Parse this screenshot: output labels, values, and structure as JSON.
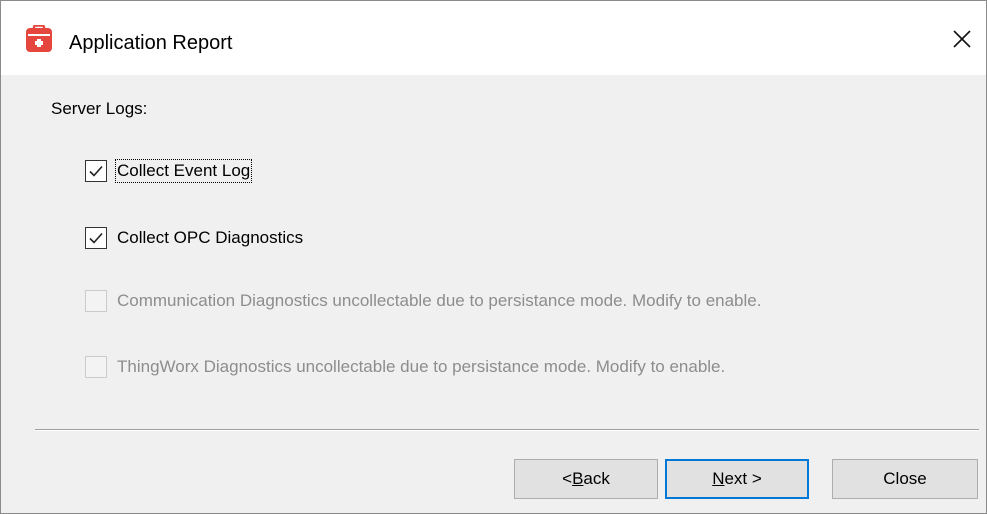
{
  "window": {
    "title": "Application Report",
    "icon": "toolbox-icon",
    "close_glyph": "✕"
  },
  "section": {
    "label": "Server Logs:"
  },
  "checkboxes": [
    {
      "label": "Collect Event Log",
      "checked": true,
      "enabled": true,
      "focused": true
    },
    {
      "label": "Collect OPC Diagnostics",
      "checked": true,
      "enabled": true,
      "focused": false
    },
    {
      "label": "Communication Diagnostics uncollectable due to persistance mode. Modify to enable.",
      "checked": false,
      "enabled": false,
      "focused": false
    },
    {
      "label": "ThingWorx Diagnostics uncollectable due to persistance mode. Modify to enable.",
      "checked": false,
      "enabled": false,
      "focused": false
    }
  ],
  "buttons": {
    "back": {
      "prefix": "< ",
      "mnemonic": "B",
      "rest": "ack"
    },
    "next": {
      "prefix": "",
      "mnemonic": "N",
      "rest": "ext >"
    },
    "close": {
      "label": "Close"
    }
  },
  "colors": {
    "accent": "#0078d7",
    "icon_red": "#e5463d",
    "disabled_text": "#8d8d8d"
  }
}
